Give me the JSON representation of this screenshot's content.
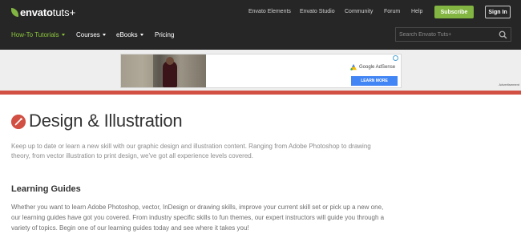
{
  "brand": {
    "name_bold": "envato",
    "name_light": "tuts+"
  },
  "topnav": {
    "links": [
      "Envato Elements",
      "Envato Studio",
      "Community",
      "Forum",
      "Help"
    ],
    "subscribe_label": "Subscribe",
    "signin_label": "Sign In"
  },
  "mainnav": {
    "items": [
      {
        "label": "How-To Tutorials",
        "dropdown": true,
        "active": true
      },
      {
        "label": "Courses",
        "dropdown": true
      },
      {
        "label": "eBooks",
        "dropdown": true
      },
      {
        "label": "Pricing",
        "dropdown": false
      }
    ]
  },
  "search": {
    "placeholder": "Search Envato Tuts+"
  },
  "ad": {
    "network": "Google AdSense",
    "cta": "LEARN MORE",
    "label": "Advertisement"
  },
  "category": {
    "title": "Design & Illustration",
    "intro": "Keep up to date or learn a new skill with our graphic design and illustration content. Ranging from Adobe Photoshop to drawing theory, from vector illustration to print design, we've got all experience levels covered."
  },
  "learning_guides": {
    "title": "Learning Guides",
    "text": "Whether you want to learn Adobe Photoshop, vector, InDesign or drawing skills, improve your current skill set or pick up a new one, our learning guides have got you covered. From industry specific skills to fun themes, our expert instructors will guide you through a variety of topics. Begin one of our learning guides today and see where it takes you!"
  },
  "colors": {
    "header_bg": "#262626",
    "brand_green": "#82b541",
    "accent_red": "#d24f43",
    "adsense_blue": "#4285f4"
  }
}
